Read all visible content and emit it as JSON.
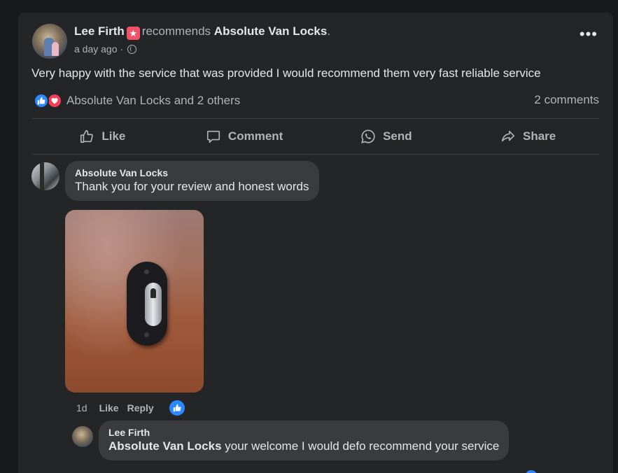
{
  "post": {
    "author": "Lee Firth",
    "recommends_text": "recommends",
    "page_name": "Absolute Van Locks",
    "period": ".",
    "timestamp": "a day ago",
    "separator": "·",
    "body": "Very happy with the service that was provided I would recommend them very fast reliable service",
    "reactions_text": "Absolute Van Locks and 2 others",
    "comments_count": "2 comments"
  },
  "actions": {
    "like": "Like",
    "comment": "Comment",
    "send": "Send",
    "share": "Share"
  },
  "comment1": {
    "author": "Absolute Van Locks",
    "text": "Thank you for your review and honest words",
    "time": "1d",
    "like_label": "Like",
    "reply_label": "Reply"
  },
  "comment2": {
    "author": "Lee Firth",
    "mention": "Absolute Van Locks",
    "text": " your welcome I would defo recommend your service"
  },
  "icons": {
    "recommend_badge": "star-icon",
    "privacy": "globe-icon",
    "more": "more-icon",
    "like_reaction": "thumbs-up-icon",
    "love_reaction": "heart-icon",
    "comment_action": "speech-bubble-icon",
    "send_action": "whatsapp-icon",
    "share_action": "share-arrow-icon"
  },
  "colors": {
    "background": "#18191a",
    "card": "#242526",
    "bubble": "#3a3b3c",
    "like_blue": "#2d88ff",
    "love_red": "#f33e58",
    "recommend_pink": "#f25268"
  }
}
